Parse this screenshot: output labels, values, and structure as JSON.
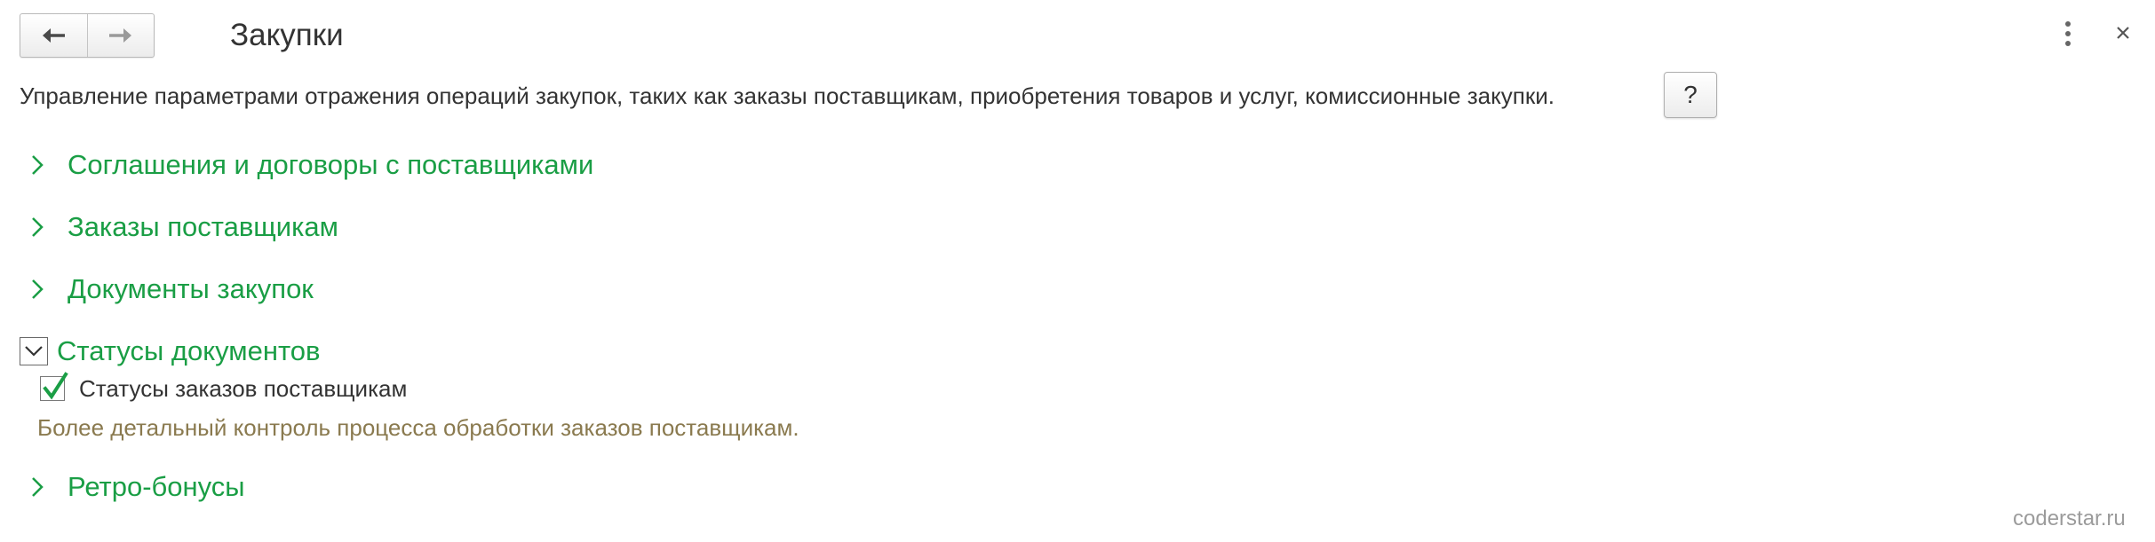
{
  "window": {
    "title": "Закупки",
    "back_icon": "arrow-left-icon",
    "forward_icon": "arrow-right-icon",
    "menu_icon": "more-vertical-icon",
    "close_icon": "close-icon"
  },
  "description": "Управление параметрами отражения операций закупок, таких как заказы поставщикам, приобретения товаров и услуг, комиссионные закупки.",
  "help_button": {
    "label": "?"
  },
  "sections": [
    {
      "label": "Соглашения и договоры с поставщиками",
      "expanded": false
    },
    {
      "label": "Заказы поставщикам",
      "expanded": false
    },
    {
      "label": "Документы закупок",
      "expanded": false
    },
    {
      "label": "Статусы документов",
      "expanded": true
    },
    {
      "label": "Ретро-бонусы",
      "expanded": false
    }
  ],
  "status_option": {
    "label": "Статусы заказов поставщикам",
    "checked": true,
    "hint": "Более детальный контроль процесса обработки заказов поставщикам."
  },
  "watermark": "coderstar.ru",
  "colors": {
    "section_text": "#1a9e45",
    "hint_text": "#8a7a4f",
    "check_mark": "#1a9e45"
  }
}
